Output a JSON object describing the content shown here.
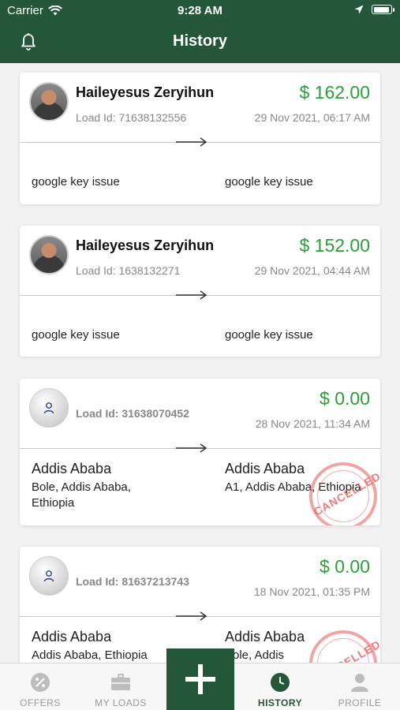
{
  "status_bar": {
    "carrier": "Carrier",
    "time": "9:28 AM"
  },
  "nav": {
    "title": "History",
    "left_icon": "bell-icon"
  },
  "colors": {
    "primary": "#24573a",
    "price_green": "#28a236",
    "stamp_red": "#e65a5a"
  },
  "cards": [
    {
      "name": "Haileyesus Zeryihun",
      "load_id": "Load Id: 71638132556",
      "price": "$ 162.00",
      "date": "29 Nov 2021, 06:17 AM",
      "from": "google key issue",
      "to": "google key issue"
    },
    {
      "name": "Haileyesus Zeryihun",
      "load_id": "Load Id: 1638132271",
      "price": "$ 152.00",
      "date": "29 Nov 2021, 04:44 AM",
      "from": "google key issue",
      "to": "google key issue"
    },
    {
      "load_id": "Load Id: 31638070452",
      "price": "$ 0.00",
      "date": "28 Nov 2021, 11:34 AM",
      "from_city": "Addis Ababa",
      "from_addr": "Bole, Addis Ababa, Ethiopia",
      "to_city": "Addis Ababa",
      "to_addr": "A1, Addis Ababa, Ethiopia",
      "stamp": "CANCELLED"
    },
    {
      "load_id": "Load Id: 81637213743",
      "price": "$ 0.00",
      "date": "18 Nov 2021, 01:35 PM",
      "from_city": "Addis Ababa",
      "from_addr": "Addis Ababa, Ethiopia",
      "to_city": "Addis Ababa",
      "to_addr": "Bole, Addis",
      "stamp": "CANCELLED"
    }
  ],
  "tabs": [
    {
      "label": "OFFERS",
      "icon": "percent-icon"
    },
    {
      "label": "MY LOADS",
      "icon": "briefcase-icon"
    },
    {
      "label": "HISTORY",
      "icon": "clock-icon",
      "active": true
    },
    {
      "label": "PROFILE",
      "icon": "person-icon"
    }
  ],
  "fab_icon": "plus-icon"
}
